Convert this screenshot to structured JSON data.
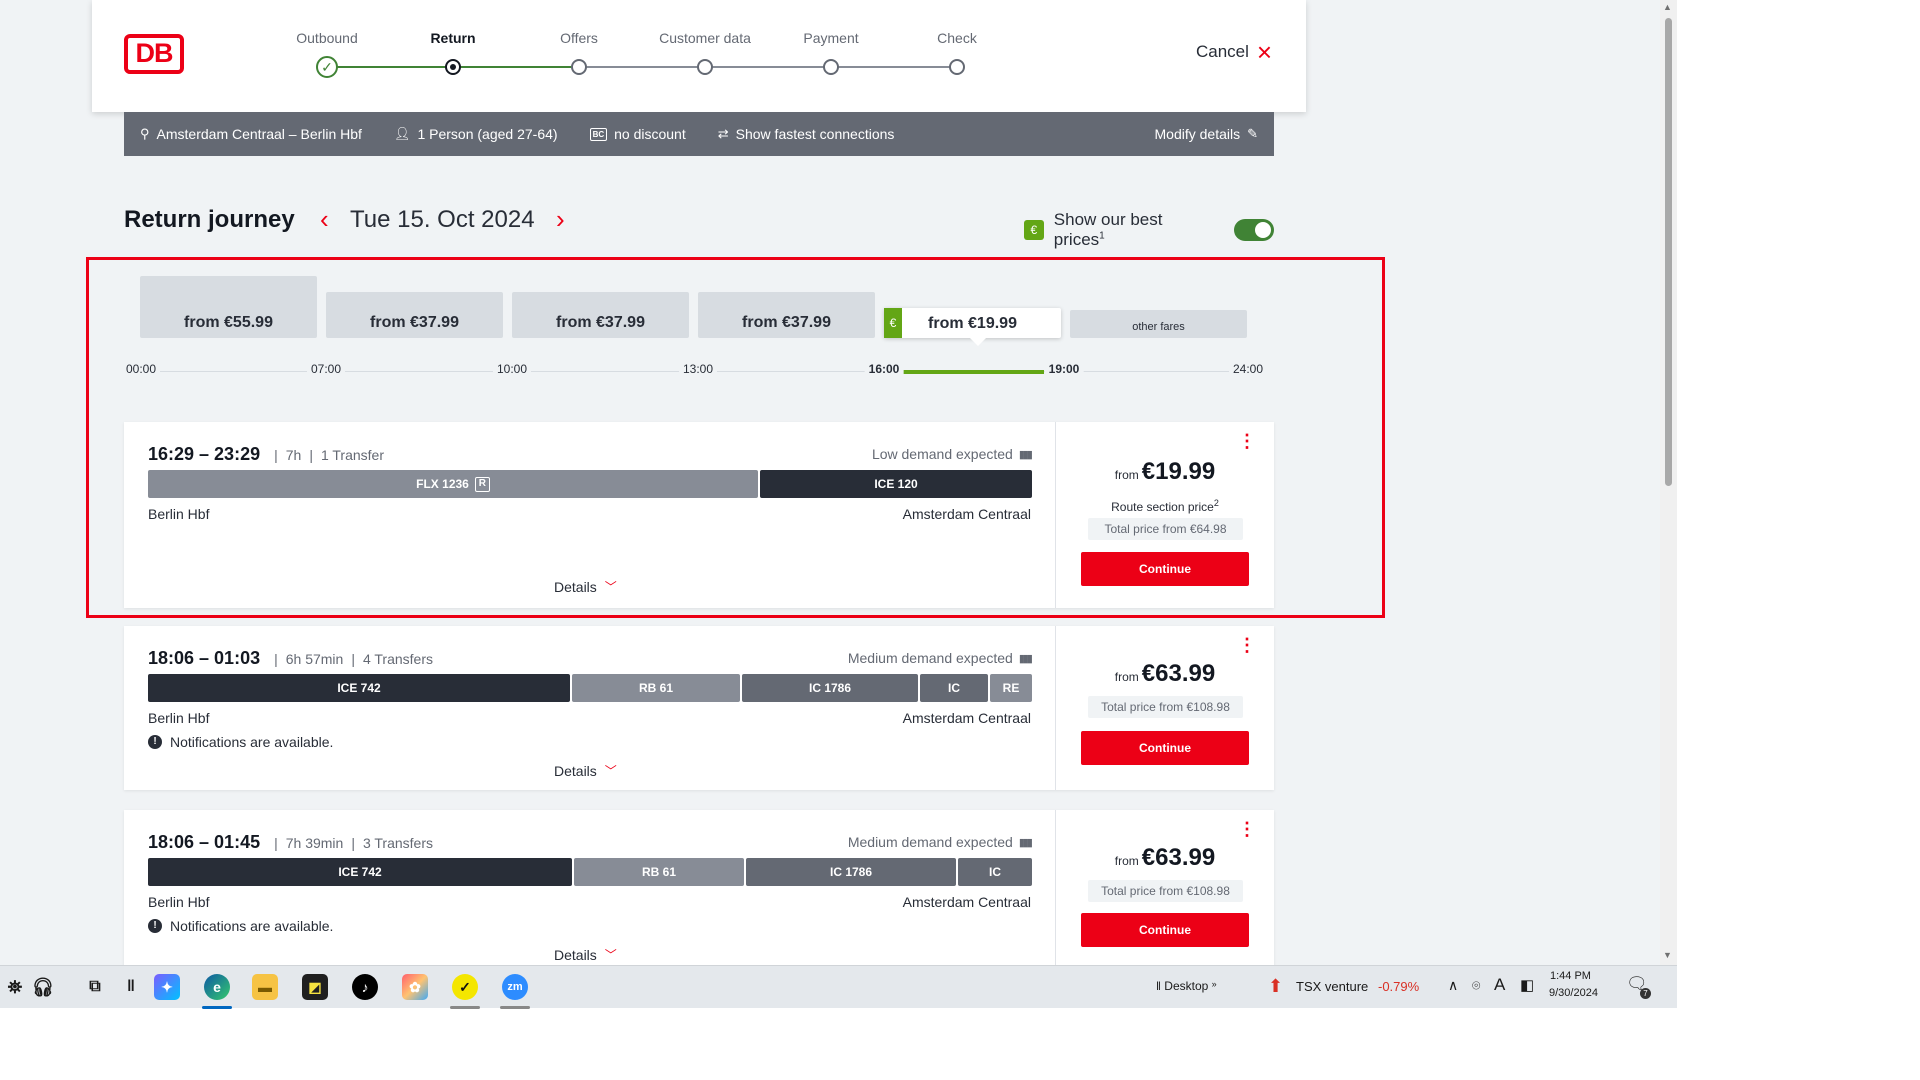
{
  "header": {
    "logo": "DB",
    "steps": [
      {
        "label": "Outbound",
        "state": "done"
      },
      {
        "label": "Return",
        "state": "active"
      },
      {
        "label": "Offers",
        "state": "todo"
      },
      {
        "label": "Customer data",
        "state": "todo"
      },
      {
        "label": "Payment",
        "state": "todo"
      },
      {
        "label": "Check",
        "state": "todo"
      }
    ],
    "cancel_label": "Cancel"
  },
  "infobar": {
    "route": "Amsterdam Centraal – Berlin Hbf",
    "passengers": "1 Person (aged 27-64)",
    "discount_badge": "BC",
    "discount": "no discount",
    "fastest": "Show fastest connections",
    "modify": "Modify details"
  },
  "title": {
    "heading": "Return journey",
    "date": "Tue 15. Oct 2024",
    "best_prices_badge": "€",
    "best_prices": "Show our best prices",
    "best_prices_sup": "1",
    "best_prices_on": true
  },
  "price_bars": [
    {
      "label": "from €55.99"
    },
    {
      "label": "from €37.99"
    },
    {
      "label": "from €37.99"
    },
    {
      "label": "from €37.99"
    },
    {
      "label": "from €19.99",
      "selected": true,
      "badge": "€"
    },
    {
      "label": "other fares"
    }
  ],
  "time_axis": [
    "00:00",
    "07:00",
    "10:00",
    "13:00",
    "16:00",
    "19:00",
    "24:00"
  ],
  "journeys": [
    {
      "times": "16:29 – 23:29",
      "duration": "7h",
      "transfers": "1 Transfer",
      "demand": "Low demand expected",
      "segments": [
        {
          "name": "FLX 1236",
          "badge": "R"
        },
        {
          "name": "ICE 120"
        }
      ],
      "from": "Berlin Hbf",
      "to": "Amsterdam Centraal",
      "notification": "",
      "details": "Details",
      "price_prefix": "from",
      "price": "€19.99",
      "route_section": "Route section price",
      "route_section_sup": "2",
      "total": "Total price from €64.98",
      "continue": "Continue"
    },
    {
      "times": "18:06 – 01:03",
      "duration": "6h 57min",
      "transfers": "4 Transfers",
      "demand": "Medium demand expected",
      "segments": [
        {
          "name": "ICE 742"
        },
        {
          "name": "RB 61"
        },
        {
          "name": "IC 1786"
        },
        {
          "name": "IC"
        },
        {
          "name": "RE"
        }
      ],
      "from": "Berlin Hbf",
      "to": "Amsterdam Centraal",
      "notification": "Notifications are available.",
      "details": "Details",
      "price_prefix": "from",
      "price": "€63.99",
      "total": "Total price from €108.98",
      "continue": "Continue"
    },
    {
      "times": "18:06 – 01:45",
      "duration": "7h 39min",
      "transfers": "3 Transfers",
      "demand": "Medium demand expected",
      "segments": [
        {
          "name": "ICE 742"
        },
        {
          "name": "RB 61"
        },
        {
          "name": "IC 1786"
        },
        {
          "name": "IC"
        }
      ],
      "from": "Berlin Hbf",
      "to": "Amsterdam Centraal",
      "notification": "Notifications are available.",
      "details": "Details",
      "price_prefix": "from",
      "price": "€63.99",
      "total": "Total price from €108.98",
      "continue": "Continue"
    }
  ],
  "taskbar": {
    "desktop": "Desktop",
    "ticker_name": "TSX venture",
    "ticker_change": "-0.79%",
    "time": "1:44 PM",
    "date": "9/30/2024",
    "notifications": "7",
    "zoom_label": "zm"
  }
}
